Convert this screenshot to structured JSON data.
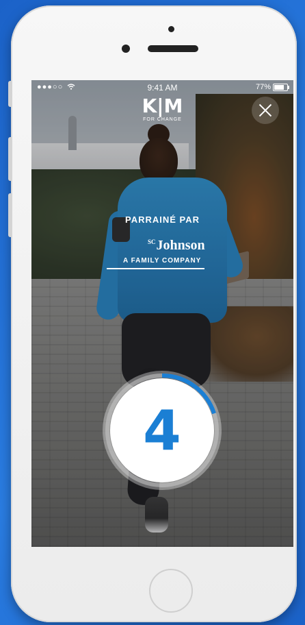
{
  "status_bar": {
    "signal": "●●●○○",
    "time": "9:41 AM",
    "battery_text": "77%",
    "battery_level": 0.77
  },
  "header": {
    "logo_mark": "K|M",
    "logo_tag": "FOR CHANGE"
  },
  "sponsor": {
    "label": "PARRAINÉ PAR",
    "brand_sc": "SC",
    "brand_name": "Johnson",
    "brand_tagline": "A FAMILY COMPANY"
  },
  "countdown": {
    "value": "4",
    "progress": 0.2,
    "ring_color": "#1b7fd4"
  },
  "colors": {
    "accent": "#1b7fd4",
    "background": "#1f6fd4"
  },
  "icons": {
    "close": "close-icon",
    "wifi": "wifi-icon",
    "battery": "battery-icon"
  }
}
